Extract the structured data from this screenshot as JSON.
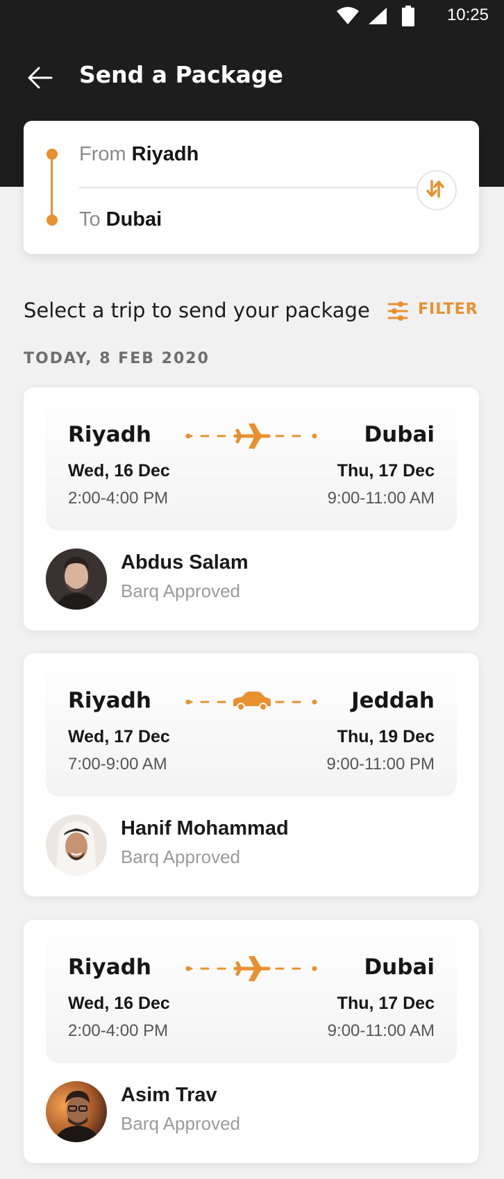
{
  "status_bar": {
    "time": "10:25",
    "icons": [
      "wifi-icon",
      "signal-icon",
      "battery-icon"
    ]
  },
  "header": {
    "back_icon": "arrow-left-icon",
    "title": "Send a Package"
  },
  "route": {
    "from_prefix": "From",
    "from_city": "Riyadh",
    "to_prefix": "To",
    "to_city": "Dubai",
    "swap_icon": "swap-vertical-icon"
  },
  "section": {
    "heading": "Select a trip to send your package",
    "filter_label": "FILTER",
    "filter_icon": "sliders-icon",
    "date_label": "TODAY, 8 FEB 2020"
  },
  "trips": [
    {
      "from_city": "Riyadh",
      "to_city": "Dubai",
      "transport_icon": "plane-icon",
      "from_date": "Wed, 16 Dec",
      "from_time": "2:00-4:00 PM",
      "to_date": "Thu, 17 Dec",
      "to_time": "9:00-11:00 AM",
      "traveler_name": "Abdus Salam",
      "traveler_status": "Barq Approved",
      "avatar_icon": "avatar-photo"
    },
    {
      "from_city": "Riyadh",
      "to_city": "Jeddah",
      "transport_icon": "car-icon",
      "from_date": "Wed, 17 Dec",
      "from_time": "7:00-9:00 AM",
      "to_date": "Thu, 19 Dec",
      "to_time": "9:00-11:00 PM",
      "traveler_name": "Hanif Mohammad",
      "traveler_status": "Barq Approved",
      "avatar_icon": "avatar-photo"
    },
    {
      "from_city": "Riyadh",
      "to_city": "Dubai",
      "transport_icon": "plane-icon",
      "from_date": "Wed, 16 Dec",
      "from_time": "2:00-4:00 PM",
      "to_date": "Thu, 17 Dec",
      "to_time": "9:00-11:00 AM",
      "traveler_name": "Asim Trav",
      "traveler_status": "Barq Approved",
      "avatar_icon": "avatar-photo"
    }
  ],
  "colors": {
    "accent": "#e8902e",
    "header_bg": "#1d1d1d",
    "page_bg": "#f1f1f1",
    "card_bg": "#ffffff"
  }
}
